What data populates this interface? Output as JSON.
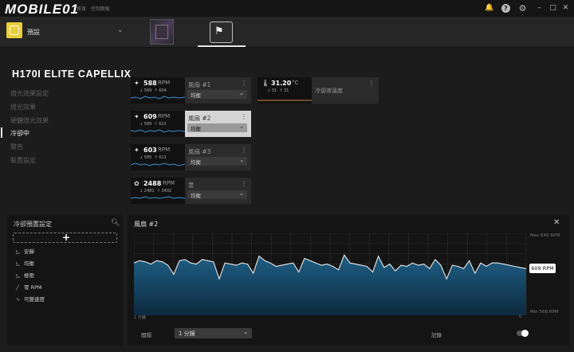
{
  "brand": {
    "logo_text": "MOBILE01"
  },
  "titlebar": {
    "menu": [
      "首頁",
      "控制面板"
    ],
    "icons": [
      "bell-icon",
      "help-icon",
      "settings-icon",
      "minimize-icon",
      "maximize-icon",
      "close-icon"
    ]
  },
  "preset": {
    "label": "預設",
    "icon": "preset-hex-icon",
    "accent": "#e9cf38"
  },
  "devices": [
    {
      "name": "motherboard-device"
    },
    {
      "name": "corsair-cooler-device",
      "selected": true
    }
  ],
  "device_title": "H170I ELITE CAPELLIX",
  "nav": [
    {
      "label": "燈光效果設定",
      "active": false
    },
    {
      "label": "燈光效果",
      "active": false
    },
    {
      "label": "硬體燈光效果",
      "active": false
    },
    {
      "label": "冷卻中",
      "active": true
    },
    {
      "label": "警告",
      "active": false
    },
    {
      "label": "裝置設定",
      "active": false
    }
  ],
  "fans": [
    {
      "value": "588",
      "unit": "RPM",
      "min": "569",
      "max": "604",
      "name": "風扇 #1",
      "mode": "均衡",
      "selected": false
    },
    {
      "value": "609",
      "unit": "RPM",
      "min": "589",
      "max": "621",
      "name": "風扇 #2",
      "mode": "均衡",
      "selected": true
    },
    {
      "value": "603",
      "unit": "RPM",
      "min": "585",
      "max": "611",
      "name": "風扇 #3",
      "mode": "均衡",
      "selected": false
    },
    {
      "value": "2488",
      "unit": "RPM",
      "min": "2481",
      "max": "2492",
      "name": "泵",
      "mode": "均衡",
      "selected": false
    }
  ],
  "temp": {
    "value": "31.20",
    "unit": "°C",
    "min": "31",
    "max": "31",
    "name": "冷卻液溫度"
  },
  "preset_panel": {
    "title": "冷卻預置設定",
    "items": [
      {
        "label": "安靜"
      },
      {
        "label": "均衡"
      },
      {
        "label": "極限"
      },
      {
        "label": "零 RPM"
      },
      {
        "label": "可變速度"
      }
    ]
  },
  "chart_panel": {
    "title": "風扇 #2",
    "max_label": "Max 640 RPM",
    "min_label": "Min 568 RPM",
    "x_start": "1 分鐘",
    "x_end": "0",
    "current": "609 RPM",
    "interval_label": "間隔",
    "interval_value": "1 分鐘",
    "record_label": "記錄",
    "record_on": true
  },
  "chart_data": {
    "type": "area",
    "ylim": [
      568,
      640
    ],
    "series": [
      {
        "values": [
          614,
          616,
          615,
          613,
          616,
          615,
          612,
          604,
          616,
          617,
          614,
          613,
          617,
          616,
          615,
          600,
          614,
          613,
          612,
          614,
          613,
          605,
          620,
          616,
          614,
          611,
          612,
          613,
          614,
          606,
          618,
          616,
          614,
          612,
          613,
          611,
          608,
          621,
          614,
          613,
          612,
          611,
          606,
          620,
          610,
          613,
          607,
          612,
          611,
          614,
          612,
          613,
          609,
          617,
          612,
          600,
          612,
          611,
          609,
          616,
          605,
          614,
          611,
          614,
          614,
          613,
          612,
          611,
          610,
          609
        ]
      }
    ]
  }
}
